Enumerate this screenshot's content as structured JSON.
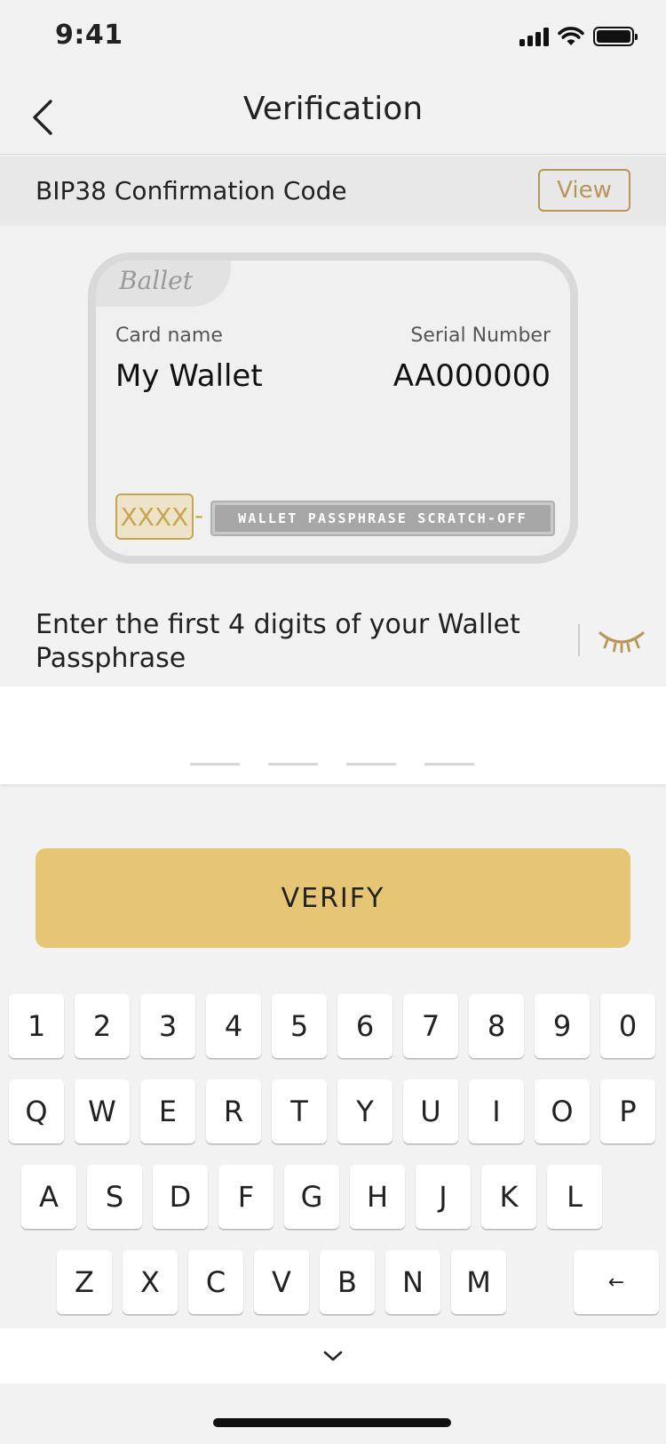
{
  "status_bar": {
    "time": "9:41"
  },
  "nav": {
    "title": "Verification"
  },
  "bip38": {
    "label": "BIP38 Confirmation Code",
    "view_label": "View"
  },
  "card": {
    "brand": "Ballet",
    "name_label": "Card name",
    "name_value": "My Wallet",
    "serial_label": "Serial Number",
    "serial_value": "AA000000",
    "passphrase_prefix": "XXXX",
    "dash": "-",
    "scratch_label": "WALLET PASSPHRASE SCRATCH-OFF"
  },
  "prompt": {
    "text": "Enter the first 4 digits of your Wallet Passphrase"
  },
  "code_input": {
    "slots": 4
  },
  "verify": {
    "label": "VERIFY"
  },
  "keyboard": {
    "row1": [
      "1",
      "2",
      "3",
      "4",
      "5",
      "6",
      "7",
      "8",
      "9",
      "0"
    ],
    "row2": [
      "Q",
      "W",
      "E",
      "R",
      "T",
      "Y",
      "U",
      "I",
      "O",
      "P"
    ],
    "row3": [
      "A",
      "S",
      "D",
      "F",
      "G",
      "H",
      "J",
      "K",
      "L"
    ],
    "row4": [
      "Z",
      "X",
      "C",
      "V",
      "B",
      "N",
      "M"
    ],
    "backspace": "←"
  },
  "colors": {
    "accent": "#b9955a",
    "button": "#e6c675",
    "card_border": "#d9d9d9"
  },
  "icons": {
    "back": "chevron-left-icon",
    "eye": "eye-closed-icon",
    "collapse": "chevron-down-icon"
  }
}
